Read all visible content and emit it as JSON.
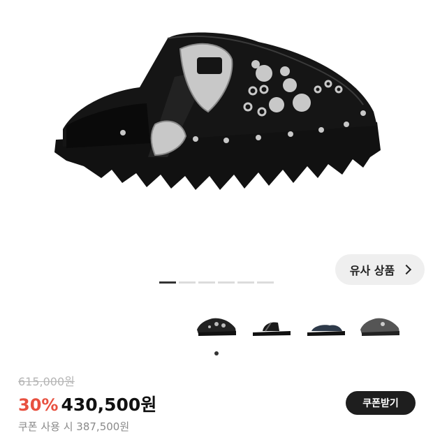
{
  "product": {
    "image_alt": "black leather western buckle studded clog mule",
    "similar_button_label": "유사 상품",
    "carousel": {
      "total": 6,
      "active": 0
    },
    "variants": [
      {
        "name": "variant-studded-clog",
        "color": "#2a2a2a"
      },
      {
        "name": "variant-strap-sandal",
        "color": "#1a1a1a"
      },
      {
        "name": "variant-navy-sandal",
        "color": "#2e3a4a"
      },
      {
        "name": "variant-grey-clog",
        "color": "#555555"
      }
    ],
    "selected_variant": 0
  },
  "price": {
    "original": "615,000원",
    "discount_rate": "30%",
    "sale": "430,500원",
    "coupon_text": "쿠폰 사용 시 387,500원",
    "coupon_button_label": "쿠폰받기"
  },
  "colors": {
    "discount": "#e8503f",
    "dark_button": "#1e1e1e",
    "accent_silver": "#c8c8c8"
  }
}
